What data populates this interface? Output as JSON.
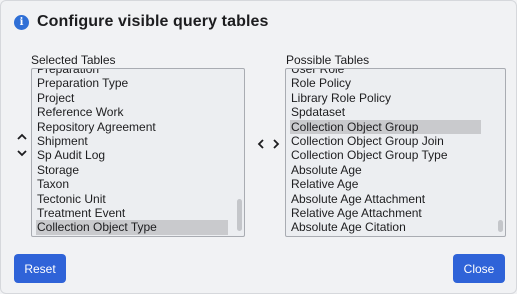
{
  "dialog": {
    "title": "Configure visible query tables",
    "icon": "info-icon"
  },
  "selected": {
    "label": "Selected Tables",
    "items": [
      "Preparation",
      "Preparation Type",
      "Project",
      "Reference Work",
      "Repository Agreement",
      "Shipment",
      "Sp Audit Log",
      "Storage",
      "Taxon",
      "Tectonic Unit",
      "Treatment Event",
      "Collection Object Type"
    ],
    "selected_item": "Collection Object Type"
  },
  "possible": {
    "label": "Possible Tables",
    "items": [
      "User Role",
      "Role Policy",
      "Library Role Policy",
      "Spdataset",
      "Collection Object Group",
      "Collection Object Group Join",
      "Collection Object Group Type",
      "Absolute Age",
      "Relative Age",
      "Absolute Age Attachment",
      "Relative Age Attachment",
      "Absolute Age Citation"
    ],
    "selected_item": "Collection Object Group"
  },
  "buttons": {
    "reset": "Reset",
    "close": "Close"
  },
  "colors": {
    "accent": "#2f63d8",
    "selection": "#c9cacd",
    "list_background": "#eceef1"
  }
}
